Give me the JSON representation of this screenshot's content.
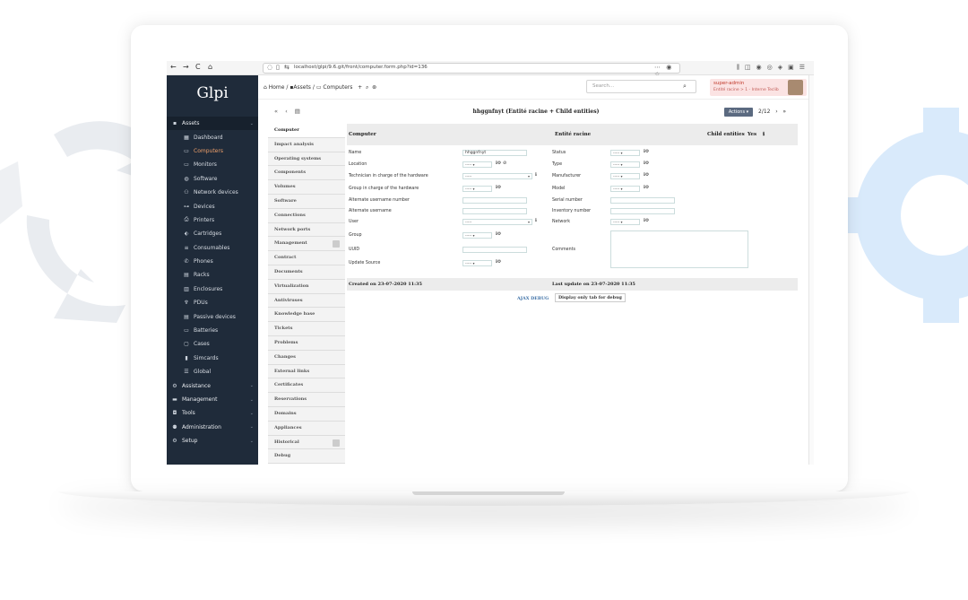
{
  "browser": {
    "url": "localhost/glpi/9.6.git/front/computer.form.php?id=136",
    "nav_back": "←",
    "nav_forward": "→",
    "reload": "C",
    "home": "⌂",
    "right_icons": "⋯ ◉ ☆"
  },
  "app": {
    "logo": "Glpi",
    "menu": [
      {
        "label": "Assets",
        "icon": "▪",
        "level": "top",
        "header": true,
        "chev": "⌄"
      },
      {
        "label": "Dashboard",
        "icon": "▦"
      },
      {
        "label": "Computers",
        "icon": "▭",
        "active": true
      },
      {
        "label": "Monitors",
        "icon": "▭"
      },
      {
        "label": "Software",
        "icon": "◍"
      },
      {
        "label": "Network devices",
        "icon": "⚇"
      },
      {
        "label": "Devices",
        "icon": "⊶"
      },
      {
        "label": "Printers",
        "icon": "⎙"
      },
      {
        "label": "Cartridges",
        "icon": "⬖"
      },
      {
        "label": "Consumables",
        "icon": "≡"
      },
      {
        "label": "Phones",
        "icon": "✆"
      },
      {
        "label": "Racks",
        "icon": "▤"
      },
      {
        "label": "Enclosures",
        "icon": "▥"
      },
      {
        "label": "PDUs",
        "icon": "♆"
      },
      {
        "label": "Passive devices",
        "icon": "▤"
      },
      {
        "label": "Batteries",
        "icon": "▭"
      },
      {
        "label": "Cases",
        "icon": "▢"
      },
      {
        "label": "Simcards",
        "icon": "▮"
      },
      {
        "label": "Global",
        "icon": "☰"
      },
      {
        "label": "Assistance",
        "icon": "⚙",
        "level": "top",
        "chev": "⌄"
      },
      {
        "label": "Management",
        "icon": "▬",
        "level": "top",
        "chev": "⌄"
      },
      {
        "label": "Tools",
        "icon": "◘",
        "level": "top",
        "chev": "⌄"
      },
      {
        "label": "Administration",
        "icon": "⚉",
        "level": "top",
        "chev": "⌄"
      },
      {
        "label": "Setup",
        "icon": "⚙",
        "level": "top",
        "chev": "⌄"
      }
    ]
  },
  "header": {
    "home": "Home",
    "assets": "Assets",
    "computers": "Computers",
    "sep": "/",
    "add": "+",
    "search_icon": "⌕",
    "lists": "⊛",
    "search_placeholder": "Search...",
    "user_name": "super-admin",
    "entity": "Entité racine > 1 - Interne Teclib"
  },
  "toolbar": {
    "title": "hhggnfnyt (Entité racine + Child entities)",
    "actions": "Actions",
    "counter": "2/12",
    "first": "«",
    "prev": "‹",
    "next": "›",
    "last": "»",
    "list": "▤"
  },
  "tabs": [
    "Computer",
    "Impact analysis",
    "Operating systems",
    "Components",
    "Volumes",
    "Software",
    "Connections",
    "Network ports",
    "Management",
    "Contract",
    "Documents",
    "Virtualization",
    "Antiviruses",
    "Knowledge base",
    "Tickets",
    "Problems",
    "Changes",
    "External links",
    "Certificates",
    "Reservations",
    "Domains",
    "Appliances",
    "Historical",
    "Debug"
  ],
  "form": {
    "h_computer": "Computer",
    "h_entity": "Entité racine",
    "h_child": "Child entities",
    "h_child_val": "Yes",
    "labels_left": [
      "Name",
      "Location",
      "Technician in charge of the hardware",
      "Group in charge of the hardware",
      "Alternate username number",
      "Alternate username",
      "User",
      "Group",
      "UUID",
      "Update Source"
    ],
    "labels_right": [
      "Status",
      "Type",
      "Manufacturer",
      "Model",
      "Serial number",
      "Inventory number",
      "Network",
      "Comments"
    ],
    "name_value": "hhggnfnyt",
    "dash": "-----",
    "created": "Created on 23-07-2020 11:35",
    "updated": "Last update on 23-07-2020 11:35",
    "ajax_debug": "AJAX DEBUG",
    "debug_btn": "Display only tab for debug"
  }
}
